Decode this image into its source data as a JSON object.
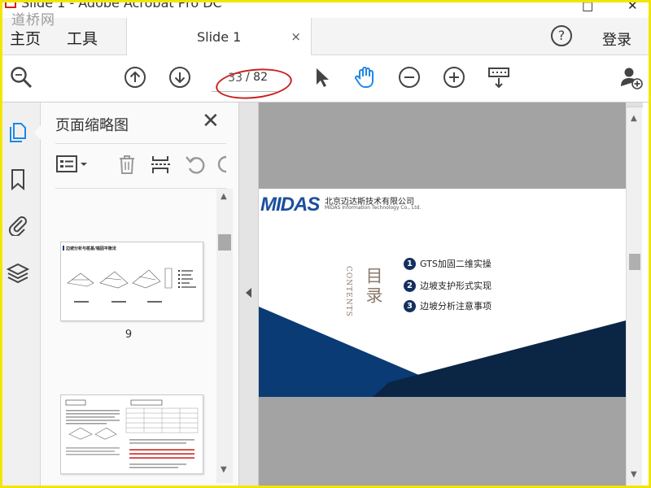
{
  "window": {
    "title": "Slide 1 - Adobe Acrobat Pro DC",
    "watermark": "道桥网",
    "minimize": "–",
    "maximize": "□",
    "close": "✕"
  },
  "tabs": {
    "home": "主页",
    "tools": "工具",
    "document_tab": "Slide 1",
    "document_tab_close": "×",
    "help": "?",
    "login": "登录"
  },
  "toolbar": {
    "current_page": "33",
    "total_pages": "/ 82",
    "icons": [
      "zoom-search-icon",
      "page-up-icon",
      "page-down-icon",
      "select-pointer-icon",
      "hand-tool-icon",
      "zoom-out-icon",
      "zoom-in-icon",
      "keyboard-scroll-icon",
      "add-user-icon"
    ]
  },
  "left_rail": {
    "icons": [
      "pages-icon",
      "bookmark-icon",
      "attachment-icon",
      "layers-icon"
    ]
  },
  "thumbnail_panel": {
    "title": "页面缩略图",
    "close": "✕",
    "tools": [
      "page-options-icon",
      "delete-icon",
      "extract-icon",
      "rotate-ccw-icon",
      "rotate-cw-icon"
    ],
    "thumbnails": [
      {
        "title": "边坡分析与桩基/锚固平衡法",
        "label": "9"
      },
      {
        "title": "边坡分析与桩基/锚固平衡法",
        "label": ""
      }
    ]
  },
  "slide": {
    "logo": "MIDAS",
    "company_cn": "北京迈达斯技术有限公司",
    "company_en": "MIDAS Information Technology Co., Ltd.",
    "contents_en": "CONTENTS",
    "contents_cn": "目录",
    "agenda": [
      {
        "num": "1",
        "text": "GTS加固二维实操"
      },
      {
        "num": "2",
        "text": "边坡支护形式实现"
      },
      {
        "num": "3",
        "text": "边坡分析注意事项"
      }
    ]
  },
  "colors": {
    "accent_blue": "#1e88e5",
    "highlight_ring": "#cc1e1e",
    "slide_navy": "#0b2a52",
    "frame_yellow": "#f2e600"
  }
}
